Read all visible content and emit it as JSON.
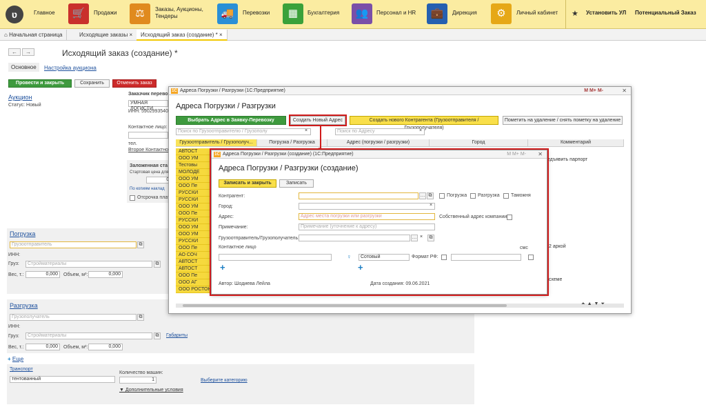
{
  "topbar": {
    "home": "Главное",
    "sales": "Продажи",
    "orders": "Заказы, Аукционы,",
    "orders2": "Тендеры",
    "transport": "Перевозки",
    "accounting": "Бухгалтерия",
    "hr": "Персонал и HR",
    "direction": "Дирекция",
    "cabinet": "Личный кабинет",
    "install": "Установить УЛ",
    "potential": "Потенциальный Заказ",
    "colors": {
      "sales": "#c9302c",
      "orders": "#e08a1e",
      "transport": "#2a8fd6",
      "accounting": "#3aa13a",
      "hr": "#7a4fa8",
      "direction": "#2560b0",
      "cabinet": "#e6a817"
    }
  },
  "tabs": [
    "Начальная страница",
    "Исходящие заказы",
    "Исходящий заказ (создание) *"
  ],
  "form": {
    "title": "Исходящий заказ (создание) *",
    "sub_tabs": [
      "Основное",
      "Настройка аукциона"
    ],
    "buttons": {
      "post": "Провести и закрыть",
      "save": "Сохранить",
      "cancel": "Отменить заказ"
    },
    "auction_link": "Аукцион",
    "status": "Статус: Новый",
    "customer_label": "Заказчик перево",
    "customer_value": "УМНАЯ ЛОГИСТИ",
    "inn": "ИНН: 5902993540",
    "contact": "Контактное лицо:",
    "tel": "тел.",
    "second_contact": "Второе Контактное",
    "pledge": "Заложенная ста",
    "start_price": "Стартовая цена для",
    "price_val": "0,00",
    "copies": "По копиям наклад",
    "deferral": "Отсрочка плат",
    "loading": {
      "title": "Погрузка",
      "shipper_ph": "Грузоотправитель",
      "inn": "ИНН:",
      "cargo_label": "Груз:",
      "cargo_ph": "Стройматериалы",
      "weight_label": "Вес, т.:",
      "weight": "0,000",
      "volume_label": "Объем, м³:",
      "volume": "0,000"
    },
    "unloading": {
      "title": "Разгрузка",
      "consignee_ph": "Грузополучатель",
      "inn": "ИНН:",
      "cargo_label": "Груз:",
      "cargo_ph": "Стройматериалы",
      "dims": "Габариты",
      "weight_label": "Вес, т.:",
      "weight": "0,000",
      "volume_label": "Объем, м³:",
      "volume": "0,000"
    },
    "more": "Еще",
    "transport_link": "Транспорт",
    "transport_value": "тентованный",
    "cars_label": "Количество машин:",
    "cars_value": "1",
    "category": "Выберите категорию",
    "extra": "▼ Дополнительные условия"
  },
  "list_window": {
    "titlebar": "Адреса Погрузки / Разгрузки (1С:Предприятие)",
    "heading": "Адреса Погрузки / Разгрузки",
    "buttons": {
      "select": "Выбрать Адрес в Заявку-Перевозку",
      "create_addr": "Создать Новый Адрес",
      "create_contr": "Создать нового Контрагента (Грузоотправителя / Грузополучателя)",
      "mark_delete": "Пометить на удаление / снять пометку на удаление"
    },
    "search_shipper_ph": "Поиск по Грузоотправителю / Грузополу",
    "search_addr_ph": "Поиск по Адресу",
    "columns": [
      "Грузоотправитель / Грузополуч...",
      "Погрузка / Разгрузка",
      "Адрес (погрузки / разгрузки)",
      "Город",
      "Комментарий"
    ],
    "rows": [
      "АВТОСТ",
      "ООО УМ",
      "Тестовы",
      "МОЛОДЕ",
      "ООО УМ",
      "ООО Пе",
      "РУССКИ",
      "РУССКИ",
      "ООО УМ",
      "ООО Пе",
      "РУССКИ",
      "ООО УМ",
      "ООО УМ",
      "РУССКИ",
      "ООО Пе",
      "АО СОЧ",
      "АВТОСТ",
      "АВТОСТ",
      "ООО Пе",
      "ООО АГ",
      "ООО РОСТОНИ"
    ],
    "comments": [
      "редъявить парпорт",
      "д 2 аркой",
      "о схеме"
    ],
    "menu": "M  M+  M-"
  },
  "create_window": {
    "titlebar": "Адреса Погрузки / Разгрузки (создание)  (1С:Предприятие)",
    "heading": "Адреса Погрузки / Разгрузки (создание)",
    "buttons": {
      "save_close": "Записать и закрыть",
      "save": "Записать"
    },
    "contractor": "Контрагент:",
    "chk_load": "Погрузка",
    "chk_unload": "Разгрузка",
    "chk_customs": "Таможня",
    "city": "Город:",
    "address": "Адрес:",
    "address_ph": "Адрес места погрузки или разгрузки",
    "own_address": "Собственный адрес компании:",
    "note": "Примечание:",
    "note_ph": "Примечание (уточнение к адресу)",
    "shipper": "Грузоотправитель/Грузополучатель:",
    "contact": "Контактное лицо",
    "sms": "смс",
    "phone_type": "Сотовый",
    "format": "Формат РФ:",
    "author": "Автор: Шодиева Лейла",
    "created": "Дата создания: 09.06.2021"
  }
}
